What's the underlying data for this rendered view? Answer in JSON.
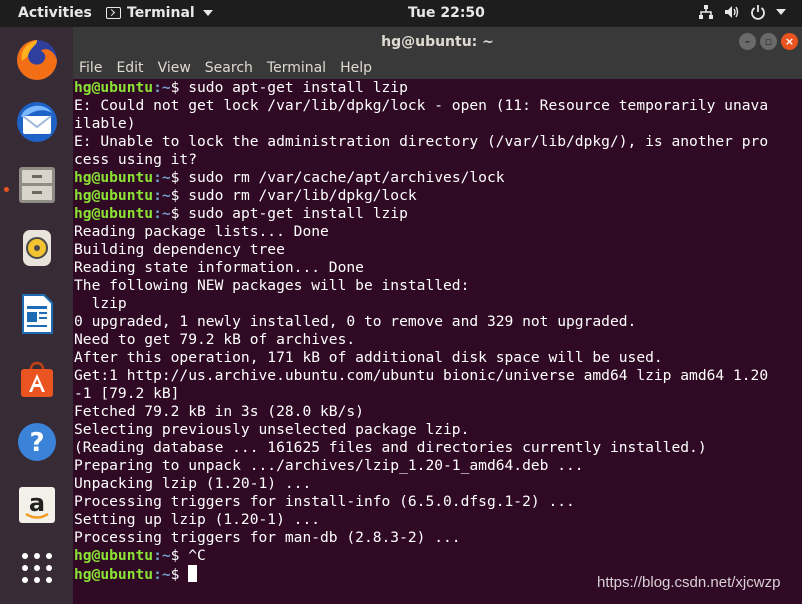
{
  "topbar": {
    "activities": "Activities",
    "app_name": "Terminal",
    "clock": "Tue 22:50",
    "tray_icons": [
      "network-icon",
      "volume-icon",
      "power-icon"
    ]
  },
  "dock": {
    "items": [
      {
        "name": "firefox-icon",
        "running": false
      },
      {
        "name": "thunderbird-icon",
        "running": false
      },
      {
        "name": "files-icon",
        "running": true
      },
      {
        "name": "rhythmbox-icon",
        "running": false
      },
      {
        "name": "libreoffice-writer-icon",
        "running": false
      },
      {
        "name": "ubuntu-software-icon",
        "running": false
      },
      {
        "name": "help-icon",
        "running": false
      },
      {
        "name": "amazon-icon",
        "running": false
      },
      {
        "name": "show-applications-icon",
        "running": false
      }
    ]
  },
  "window": {
    "title": "hg@ubuntu: ~",
    "menu": [
      "File",
      "Edit",
      "View",
      "Search",
      "Terminal",
      "Help"
    ]
  },
  "terminal": {
    "user_host": "hg@ubuntu",
    "path": ":~",
    "lines": [
      {
        "prompt": true,
        "text": "$ sudo apt-get install lzip"
      },
      {
        "prompt": false,
        "text": "E: Could not get lock /var/lib/dpkg/lock - open (11: Resource temporarily unava"
      },
      {
        "prompt": false,
        "text": "ilable)"
      },
      {
        "prompt": false,
        "text": "E: Unable to lock the administration directory (/var/lib/dpkg/), is another pro"
      },
      {
        "prompt": false,
        "text": "cess using it?"
      },
      {
        "prompt": true,
        "text": "$ sudo rm /var/cache/apt/archives/lock"
      },
      {
        "prompt": true,
        "text": "$ sudo rm /var/lib/dpkg/lock"
      },
      {
        "prompt": true,
        "text": "$ sudo apt-get install lzip"
      },
      {
        "prompt": false,
        "text": "Reading package lists... Done"
      },
      {
        "prompt": false,
        "text": "Building dependency tree"
      },
      {
        "prompt": false,
        "text": "Reading state information... Done"
      },
      {
        "prompt": false,
        "text": "The following NEW packages will be installed:"
      },
      {
        "prompt": false,
        "text": "  lzip"
      },
      {
        "prompt": false,
        "text": "0 upgraded, 1 newly installed, 0 to remove and 329 not upgraded."
      },
      {
        "prompt": false,
        "text": "Need to get 79.2 kB of archives."
      },
      {
        "prompt": false,
        "text": "After this operation, 171 kB of additional disk space will be used."
      },
      {
        "prompt": false,
        "text": "Get:1 http://us.archive.ubuntu.com/ubuntu bionic/universe amd64 lzip amd64 1.20"
      },
      {
        "prompt": false,
        "text": "-1 [79.2 kB]"
      },
      {
        "prompt": false,
        "text": "Fetched 79.2 kB in 3s (28.0 kB/s)"
      },
      {
        "prompt": false,
        "text": "Selecting previously unselected package lzip."
      },
      {
        "prompt": false,
        "text": "(Reading database ... 161625 files and directories currently installed.)"
      },
      {
        "prompt": false,
        "text": "Preparing to unpack .../archives/lzip_1.20-1_amd64.deb ..."
      },
      {
        "prompt": false,
        "text": "Unpacking lzip (1.20-1) ..."
      },
      {
        "prompt": false,
        "text": "Processing triggers for install-info (6.5.0.dfsg.1-2) ..."
      },
      {
        "prompt": false,
        "text": "Setting up lzip (1.20-1) ..."
      },
      {
        "prompt": false,
        "text": "Processing triggers for man-db (2.8.3-2) ..."
      },
      {
        "prompt": true,
        "text": "$ ^C"
      },
      {
        "prompt": true,
        "text": "$ ",
        "cursor": true
      }
    ]
  },
  "watermark": "https://blog.csdn.net/xjcwzp",
  "colors": {
    "terminal_bg": "#300a24",
    "prompt_user": "#8ae234",
    "prompt_path": "#729fcf",
    "accent": "#e95420"
  }
}
